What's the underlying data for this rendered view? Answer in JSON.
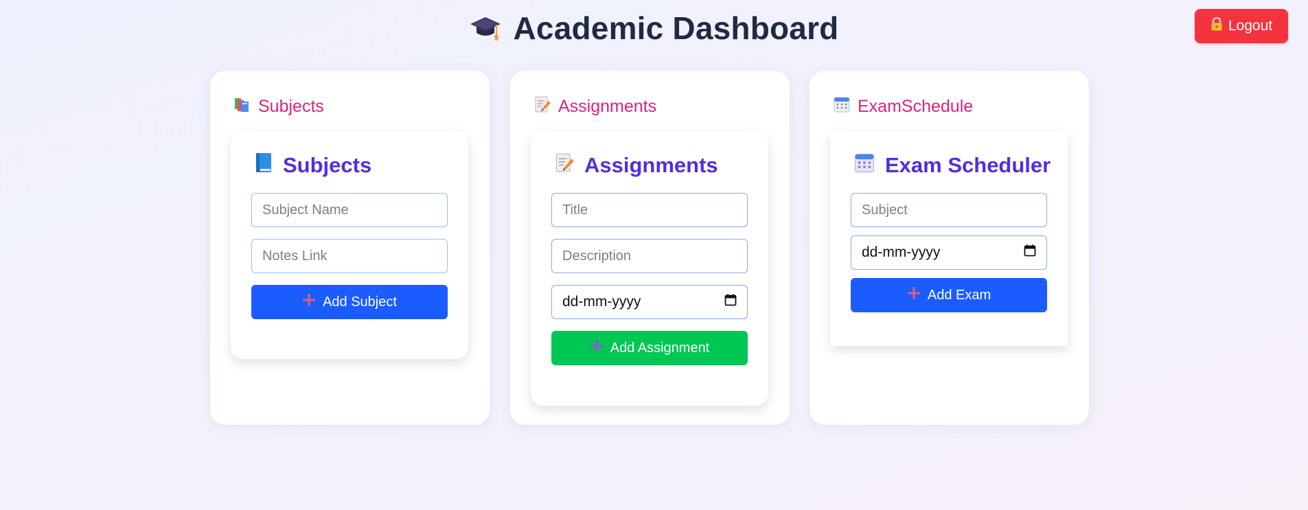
{
  "header": {
    "title": "Academic Dashboard",
    "title_icon": "graduation-cap-icon",
    "logout_label": "Logout",
    "logout_icon": "lock-icon"
  },
  "cards": [
    {
      "heading": "Subjects",
      "heading_icon": "books-icon",
      "panel_title": "Subjects",
      "panel_icon": "blue-book-icon",
      "fields": [
        {
          "placeholder": "Subject Name",
          "value": ""
        },
        {
          "placeholder": "Notes Link",
          "value": ""
        }
      ],
      "button_label": "Add Subject",
      "button_icon": "plus-icon"
    },
    {
      "heading": "Assignments",
      "heading_icon": "memo-icon",
      "panel_title": "Assignments",
      "panel_icon": "memo-icon",
      "fields": [
        {
          "placeholder": "Title",
          "value": ""
        },
        {
          "placeholder": "Description",
          "value": ""
        }
      ],
      "date_value": "dd-mm-yyyy",
      "button_label": "Add Assignment",
      "button_icon": "plus-icon"
    },
    {
      "heading": "ExamSchedule",
      "heading_icon": "calendar-icon",
      "panel_title": "Exam Scheduler",
      "panel_icon": "calendar-icon",
      "fields": [
        {
          "placeholder": "Subject",
          "value": ""
        }
      ],
      "date_value": "dd-mm-yyyy",
      "button_label": "Add Exam",
      "button_icon": "plus-icon"
    }
  ],
  "colors": {
    "heading_pink": "#e0207a",
    "panel_title_purple": "#4f2fe0",
    "primary_blue": "#1a5cff",
    "success_green": "#00c653",
    "logout_red": "#f5333f",
    "title_navy": "#1f2a44"
  }
}
